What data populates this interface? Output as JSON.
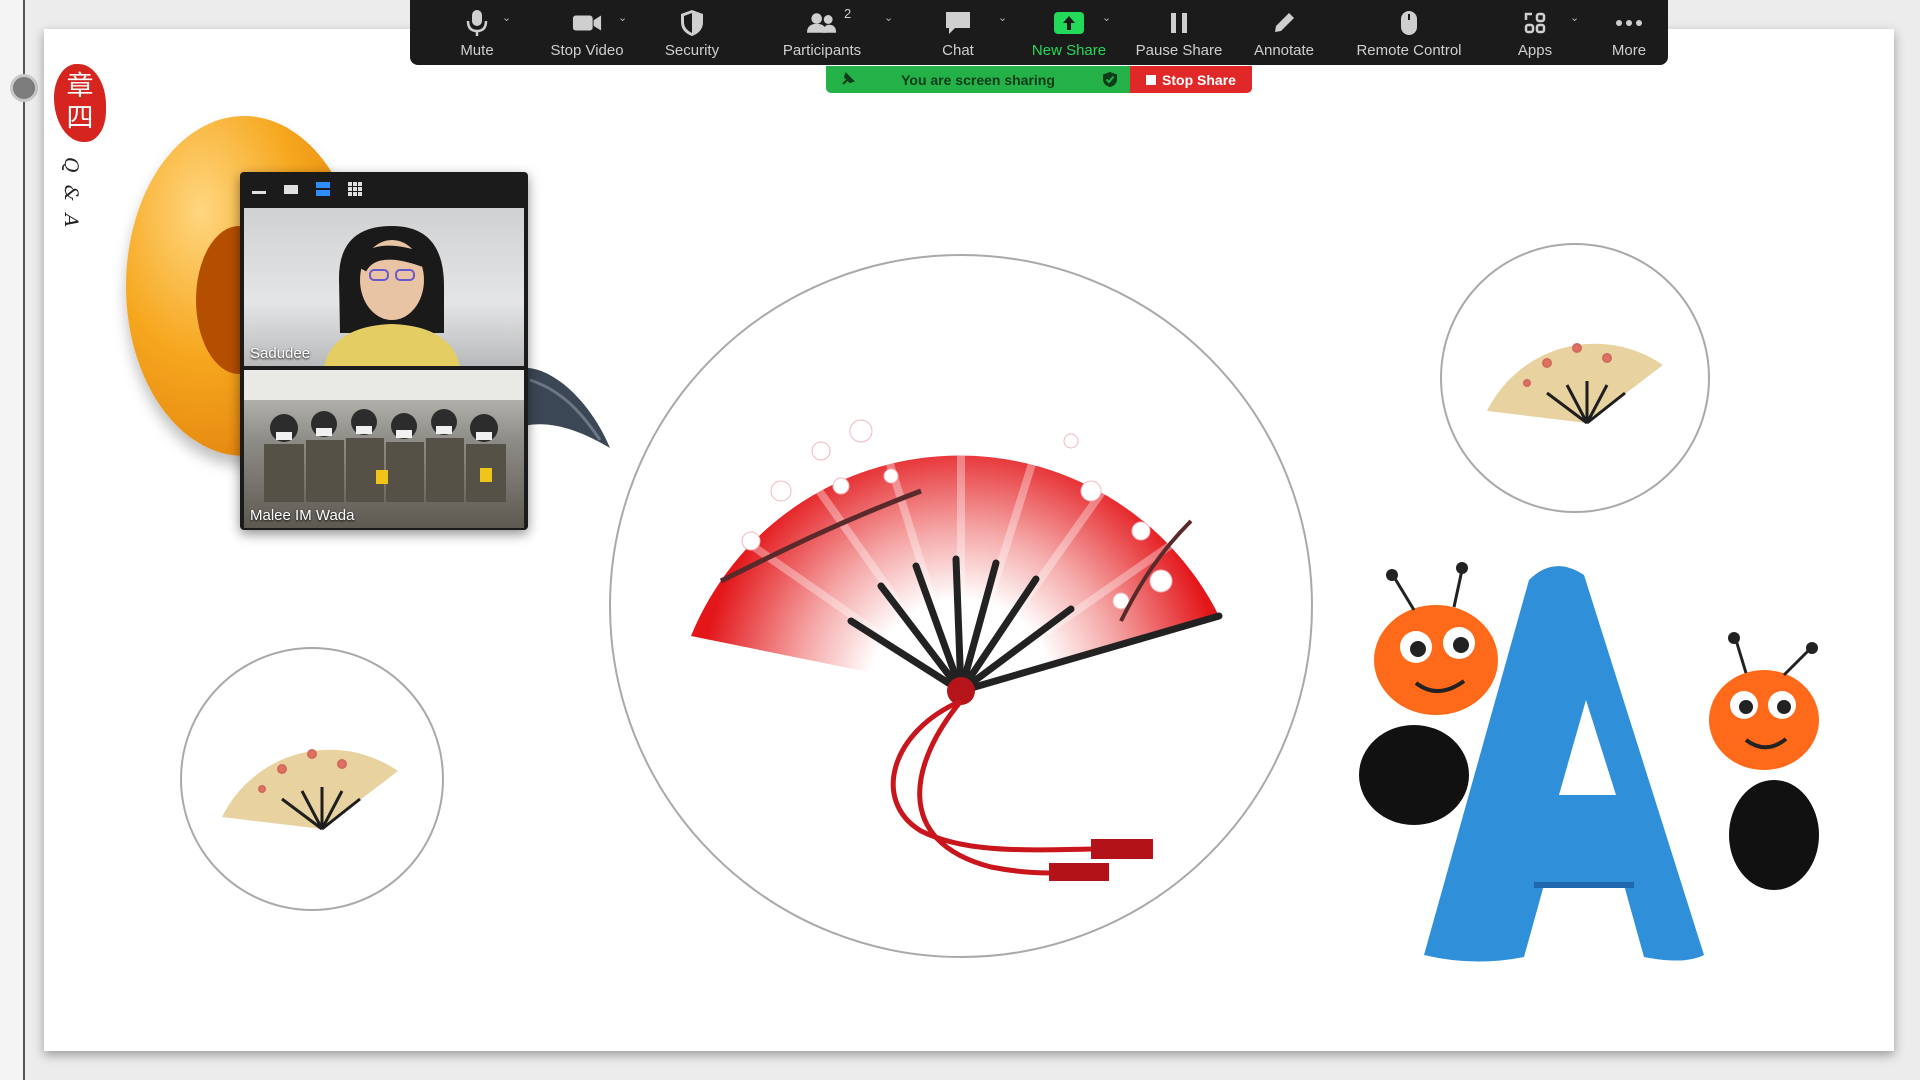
{
  "toolbar": {
    "items": [
      {
        "key": "mute",
        "label": "Mute",
        "icon": "microphone-icon"
      },
      {
        "key": "stop_video",
        "label": "Stop Video",
        "icon": "video-camera-icon"
      },
      {
        "key": "security",
        "label": "Security",
        "icon": "shield-icon"
      },
      {
        "key": "participants",
        "label": "Participants",
        "icon": "participants-icon",
        "count": "2"
      },
      {
        "key": "chat",
        "label": "Chat",
        "icon": "chat-bubble-icon"
      },
      {
        "key": "new_share",
        "label": "New Share",
        "icon": "share-screen-icon"
      },
      {
        "key": "pause_share",
        "label": "Pause Share",
        "icon": "pause-icon"
      },
      {
        "key": "annotate",
        "label": "Annotate",
        "icon": "pencil-icon"
      },
      {
        "key": "remote_control",
        "label": "Remote Control",
        "icon": "mouse-icon"
      },
      {
        "key": "apps",
        "label": "Apps",
        "icon": "apps-icon"
      },
      {
        "key": "more",
        "label": "More",
        "icon": "more-dots-icon"
      }
    ],
    "participants_count": "2"
  },
  "share_bar": {
    "status": "You are screen sharing",
    "stop_label": "Stop Share"
  },
  "video_panel": {
    "participants": [
      {
        "name": "Sadudee"
      },
      {
        "name": "Malee IM Wada"
      }
    ]
  },
  "slide": {
    "seal_text": "章四",
    "side_text": "Q & A"
  },
  "colors": {
    "toolbar_bg": "#1b1b1b",
    "share_green": "#24b248",
    "stop_red": "#e02828",
    "new_share_green": "#23d959"
  }
}
